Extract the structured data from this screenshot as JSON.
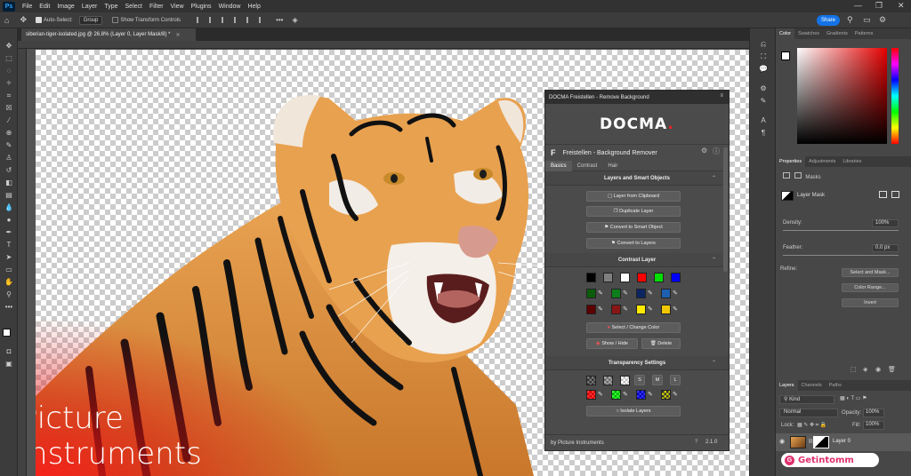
{
  "menubar": {
    "app_logo": "Ps",
    "items": [
      "File",
      "Edit",
      "Image",
      "Layer",
      "Type",
      "Select",
      "Filter",
      "View",
      "Plugins",
      "Window",
      "Help"
    ]
  },
  "options": {
    "auto_select_label": "Auto-Select:",
    "auto_select_value": "Group",
    "transform_label": "Show Transform Controls",
    "share_label": "Share"
  },
  "document": {
    "tab_title": "siberian-tiger-isolated.jpg @ 26.8% (Layer 0, Layer Mask/8) *"
  },
  "docma": {
    "title": "DOCMA Freistellen - Remove Background",
    "logo": "DOCMA",
    "plugin_letter": "F",
    "plugin_title": "Freistellen - Background Remover",
    "tabs": [
      "Basics",
      "Contrast",
      "Hair"
    ],
    "sections": {
      "layers": "Layers and Smart Objects",
      "contrast": "Contrast Layer",
      "transparency": "Transparency Settings"
    },
    "buttons": {
      "from_clipboard": "Layer from Clipboard",
      "duplicate": "Duplicate Layer",
      "smart": "Convert to Smart Object",
      "to_layers": "Convert to Layers",
      "select_color": "Select / Change Color",
      "show_hide": "Show / Hide",
      "delete": "Delete",
      "isolate": "Isolate Layers",
      "size_s": "S",
      "size_m": "M",
      "size_l": "L"
    },
    "footer_left": "by Picture Instruments",
    "footer_version": "2.1.0",
    "swatch_colors": {
      "row1": [
        "#000000",
        "#7f7f7f",
        "#ffffff",
        "#ff0000",
        "#00dd00",
        "#0000ff"
      ],
      "row2": [
        "#0b5d0b",
        "#0e7d1b",
        "#0c2460",
        "#1f5fb0"
      ],
      "row3": [
        "#5c0000",
        "#8a1515",
        "#ffea00",
        "#f0c800"
      ]
    }
  },
  "color_panel": {
    "tabs": [
      "Color",
      "Swatches",
      "Gradients",
      "Patterns"
    ]
  },
  "properties": {
    "tabs": [
      "Properties",
      "Adjustments",
      "Libraries"
    ],
    "masks_label": "Masks",
    "layer_mask_label": "Layer Mask",
    "density_label": "Density:",
    "density_value": "100%",
    "feather_label": "Feather:",
    "feather_value": "0.0 px",
    "refine_label": "Refine:",
    "select_mask": "Select and Mask...",
    "color_range": "Color Range...",
    "invert": "Invert"
  },
  "layers": {
    "tabs": [
      "Layers",
      "Channels",
      "Paths"
    ],
    "kind_label": "Kind",
    "blend_mode": "Normal",
    "opacity_label": "Opacity:",
    "opacity_value": "100%",
    "lock_label": "Lock:",
    "fill_label": "Fill:",
    "fill_value": "100%",
    "layer_name": "Layer 0"
  },
  "watermarks": {
    "left_line1": "Picture",
    "left_line2": "Instruments",
    "right": "Getintomm"
  }
}
